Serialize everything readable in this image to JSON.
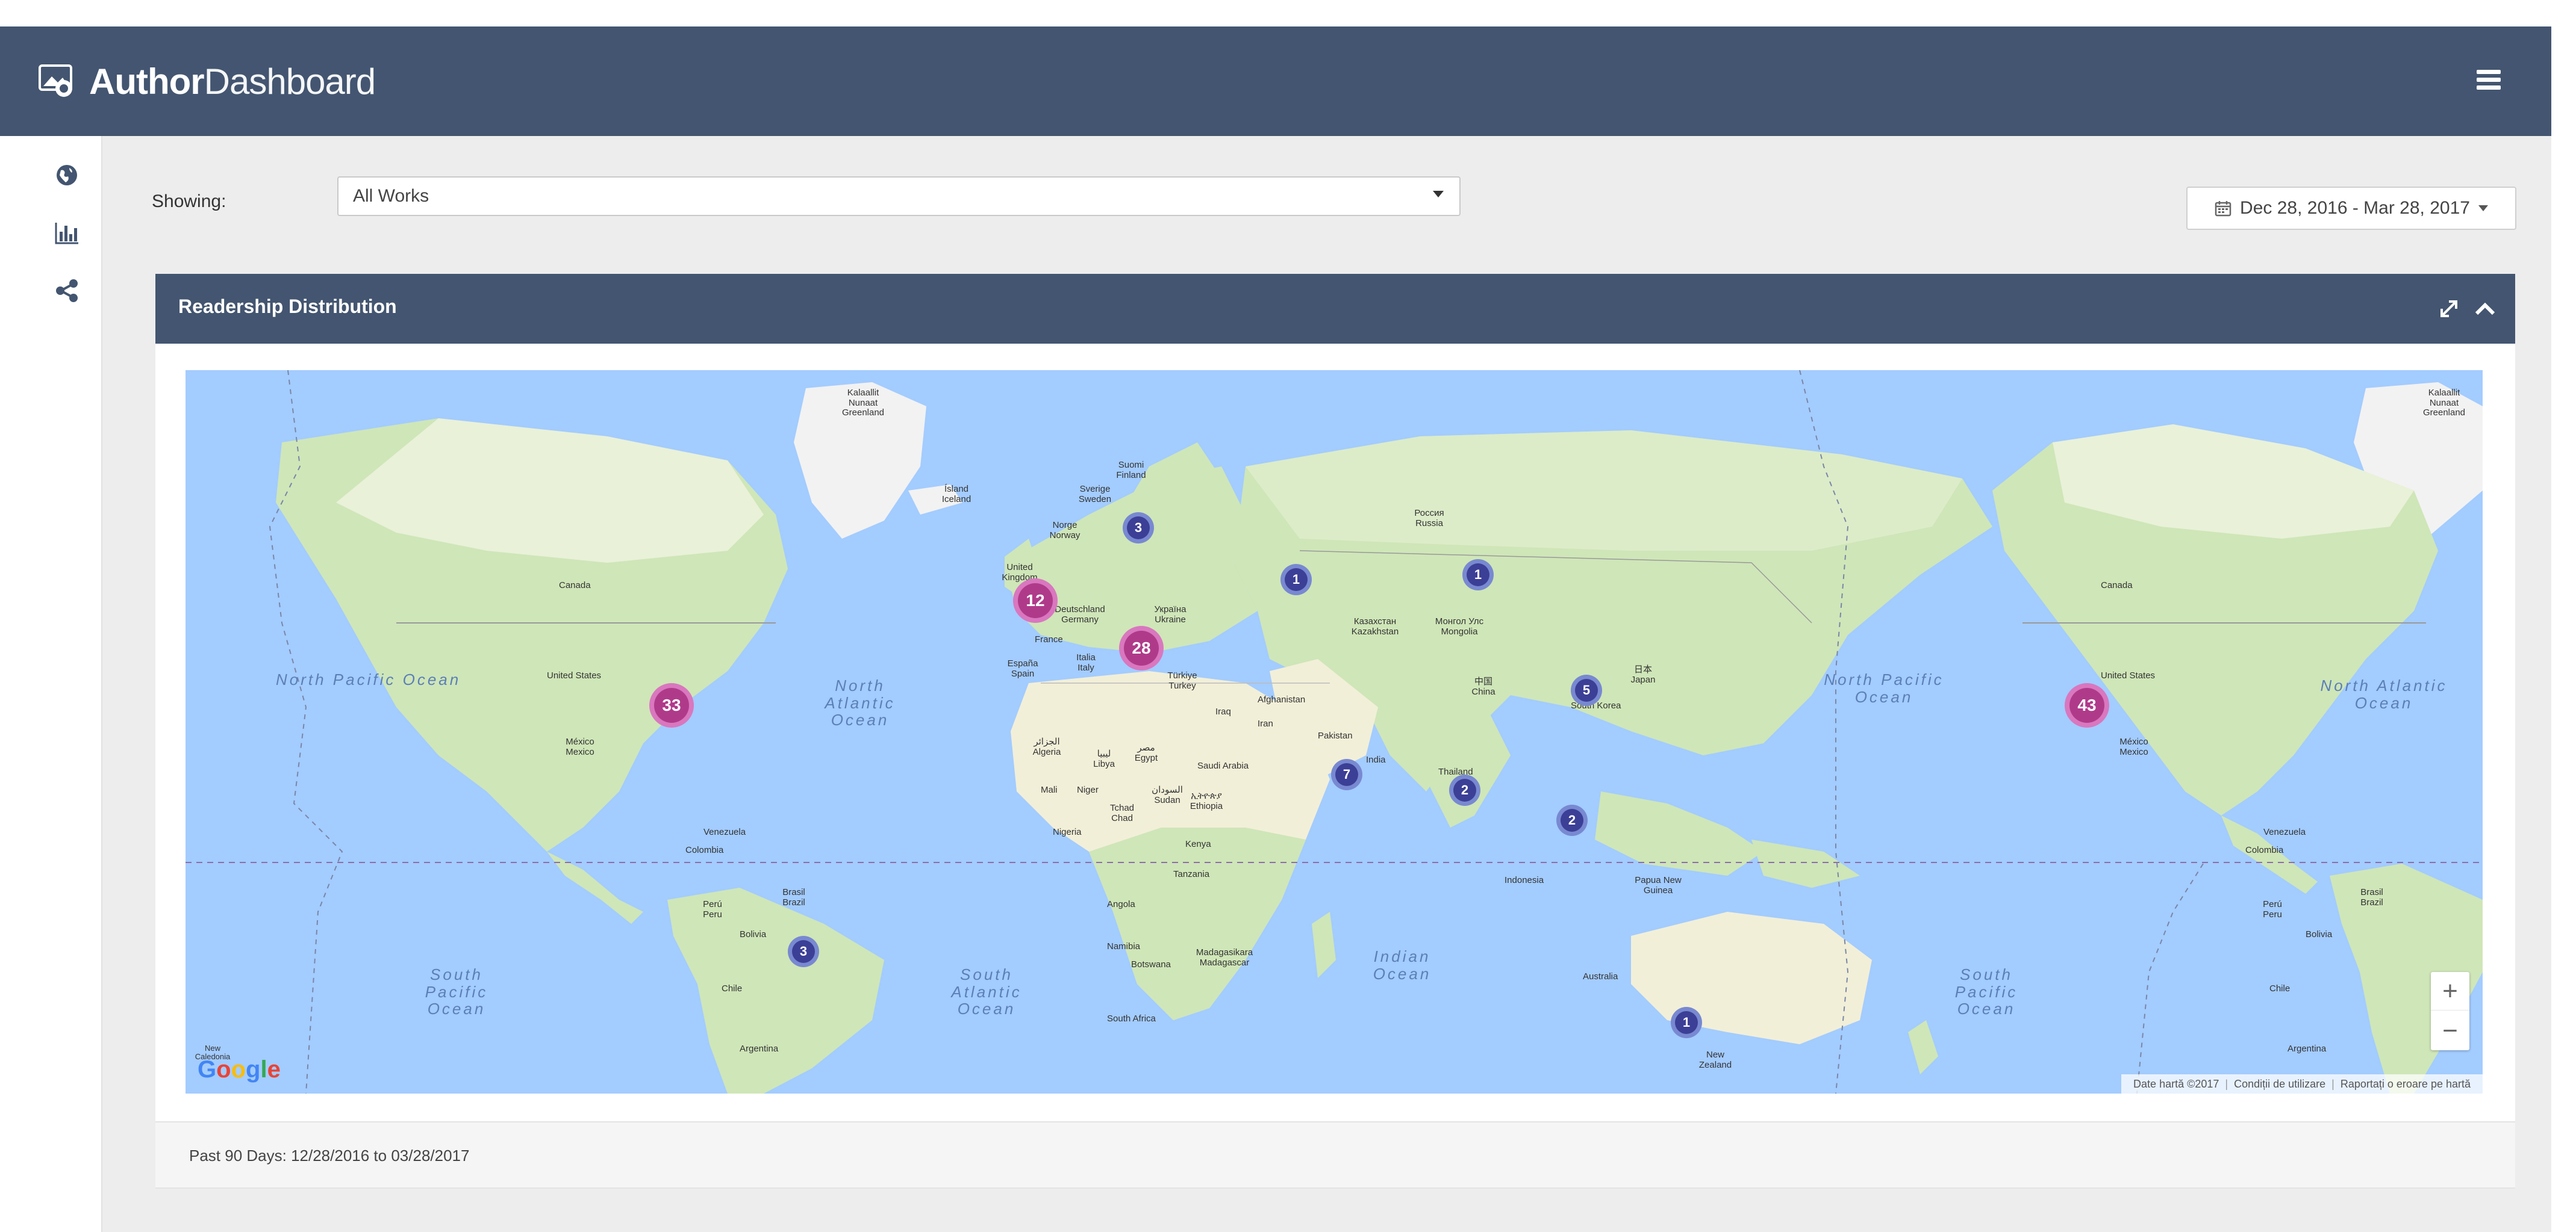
{
  "header": {
    "brand_author": "Author",
    "brand_dashboard": "Dashboard",
    "logo_icon": "book-reader-icon",
    "menu_icon": "hamburger-menu-icon"
  },
  "sidebar": {
    "items": [
      {
        "icon": "globe-icon",
        "active": true
      },
      {
        "icon": "bar-chart-icon",
        "active": false
      },
      {
        "icon": "share-icon",
        "active": false
      }
    ]
  },
  "filters": {
    "showing_label": "Showing:",
    "works_selected": "All Works",
    "date_range": "Dec 28, 2016 - Mar 28, 2017"
  },
  "panel": {
    "title": "Readership Distribution",
    "footer": "Past 90 Days: 12/28/2016 to 03/28/2017"
  },
  "map": {
    "clusters": [
      {
        "id": "usa-east",
        "count": "33",
        "type": "big"
      },
      {
        "id": "uk",
        "count": "12",
        "type": "big"
      },
      {
        "id": "europe",
        "count": "28",
        "type": "big"
      },
      {
        "id": "usa-west",
        "count": "43",
        "type": "big"
      },
      {
        "id": "scandinavia",
        "count": "3",
        "type": "small"
      },
      {
        "id": "russia-west",
        "count": "1",
        "type": "small"
      },
      {
        "id": "russia-east",
        "count": "1",
        "type": "small"
      },
      {
        "id": "korea",
        "count": "5",
        "type": "small"
      },
      {
        "id": "india",
        "count": "7",
        "type": "small"
      },
      {
        "id": "thailand",
        "count": "2",
        "type": "small"
      },
      {
        "id": "philippines",
        "count": "2",
        "type": "small"
      },
      {
        "id": "brazil",
        "count": "3",
        "type": "small"
      },
      {
        "id": "australia",
        "count": "1",
        "type": "small"
      }
    ],
    "oceans": {
      "north_pacific_left": "North Pacific Ocean",
      "north_atlantic_center": "North Atlantic Ocean",
      "south_pacific_left": "South Pacific Ocean",
      "south_atlantic": "South Atlantic Ocean",
      "indian": "Indian Ocean",
      "north_pacific_right": "North Pacific Ocean",
      "north_atlantic_right": "North Atlantic Ocean",
      "south_pacific_right": "South Pacific Ocean"
    },
    "labels": {
      "greenland": "Kalaallit Nunaat Greenland",
      "greenland_right": "Kalaallit Nunaat Greenland",
      "canada": "Canada",
      "canada_right": "Canada",
      "usa": "United States",
      "usa_right": "United States",
      "mexico": "México Mexico",
      "mexico_right": "México Mexico",
      "venezuela": "Venezuela",
      "colombia": "Colombia",
      "venezuela_right": "Venezuela",
      "colombia_right": "Colombia",
      "brazil": "Brasil Brazil",
      "brazil_right": "Brasil Brazil",
      "peru": "Perú Peru",
      "peru_right": "Perú Peru",
      "bolivia": "Bolivia",
      "bolivia_right": "Bolivia",
      "chile": "Chile",
      "chile_right": "Chile",
      "argentina": "Argentina",
      "argentina_right": "Argentina",
      "iceland": "Ísland Iceland",
      "sweden": "Sverige Sweden",
      "finland": "Suomi Finland",
      "norway": "Norge Norway",
      "uk": "United Kingdom",
      "germany": "Deutschland Germany",
      "france": "France",
      "spain": "España Spain",
      "italy": "Italia Italy",
      "ukraine": "Україна Ukraine",
      "turkey": "Türkiye Turkey",
      "russia": "Россия Russia",
      "kazakhstan": "Казахстан Kazakhstan",
      "mongolia": "Монгол Улс Mongolia",
      "china": "中国 China",
      "japan": "日本 Japan",
      "south_korea": "South Korea",
      "iraq": "Iraq",
      "iran": "Iran",
      "afghanistan": "Afghanistan",
      "pakistan": "Pakistan",
      "india": "India",
      "thailand": "Thailand",
      "saudi": "Saudi Arabia",
      "algeria": "الجزائر Algeria",
      "libya": "ليبيا Libya",
      "egypt": "مصر Egypt",
      "mali": "Mali",
      "niger": "Niger",
      "chad": "Tchad Chad",
      "sudan": "السودان Sudan",
      "ethiopia": "ኢትዮጵያ Ethiopia",
      "nigeria": "Nigeria",
      "kenya": "Kenya",
      "tanzania": "Tanzania",
      "angola": "Angola",
      "namibia": "Namibia",
      "botswana": "Botswana",
      "madagascar": "Madagasikara Madagascar",
      "south_africa": "South Africa",
      "indonesia": "Indonesia",
      "png": "Papua New Guinea",
      "australia": "Australia",
      "new_zealand": "New Zealand",
      "new_caledonia": "New Caledonia"
    },
    "google": [
      "G",
      "o",
      "o",
      "g",
      "l",
      "e"
    ],
    "footer_links": {
      "data": "Date hartă ©2017",
      "terms": "Condiții de utilizare",
      "report": "Raportați o eroare pe hartă"
    },
    "zoom_in": "+",
    "zoom_out": "−"
  },
  "colors": {
    "header_bg": "#435570",
    "ocean": "#a3ccff",
    "land": "#cfe6b8",
    "cluster_big": "#b03a8a",
    "cluster_small": "#3c3f96"
  }
}
